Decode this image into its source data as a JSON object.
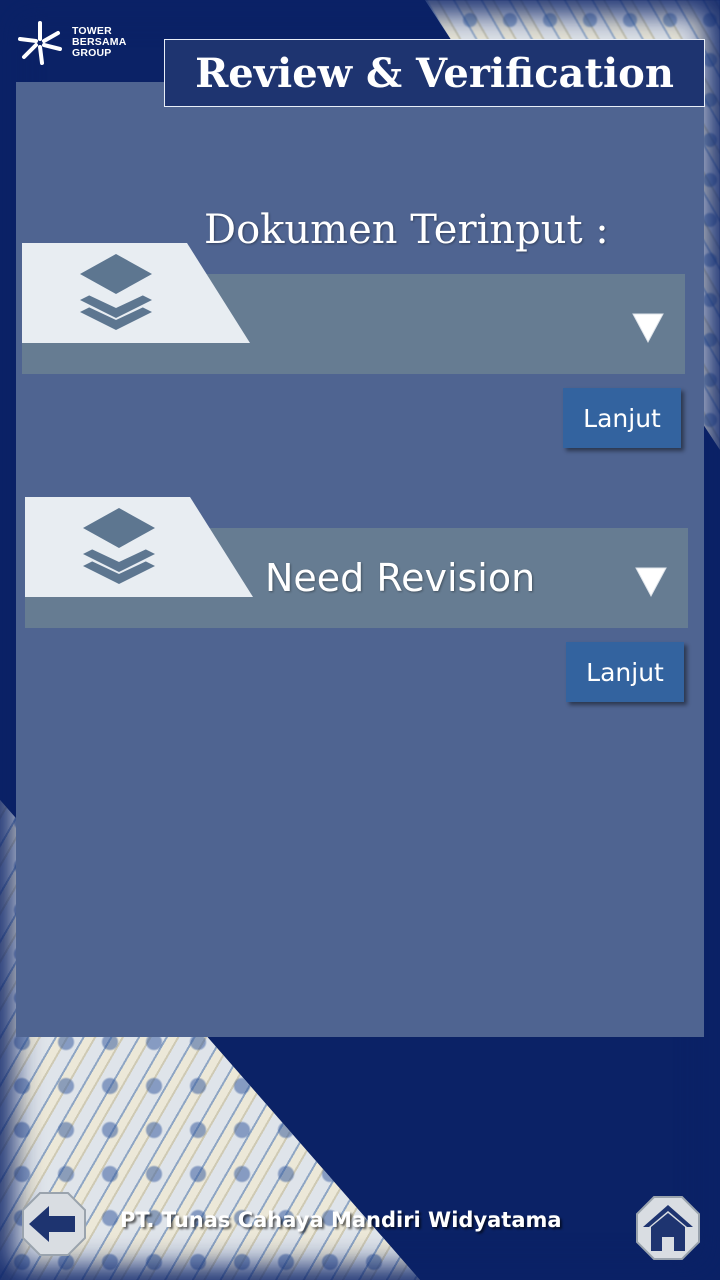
{
  "header": {
    "logo_text": "TOWER\nBERSAMA\nGROUP",
    "title": "Review & Verification"
  },
  "main": {
    "section_label": "Dokumen Terinput :",
    "dropdowns": [
      {
        "icon": "layers-icon",
        "selected_value": "",
        "button_label": "Lanjut"
      },
      {
        "icon": "layers-icon",
        "selected_value": "Need Revision",
        "button_label": "Lanjut"
      }
    ]
  },
  "footer": {
    "company": "PT. Tunas Cahaya Mandiri Widyatama",
    "back_icon": "arrow-left-icon",
    "home_icon": "home-icon"
  },
  "colors": {
    "background": "#0b2266",
    "panel": "#4f6491",
    "dropdown": "#667c92",
    "button": "#33639f",
    "title_box": "#1e3470"
  }
}
